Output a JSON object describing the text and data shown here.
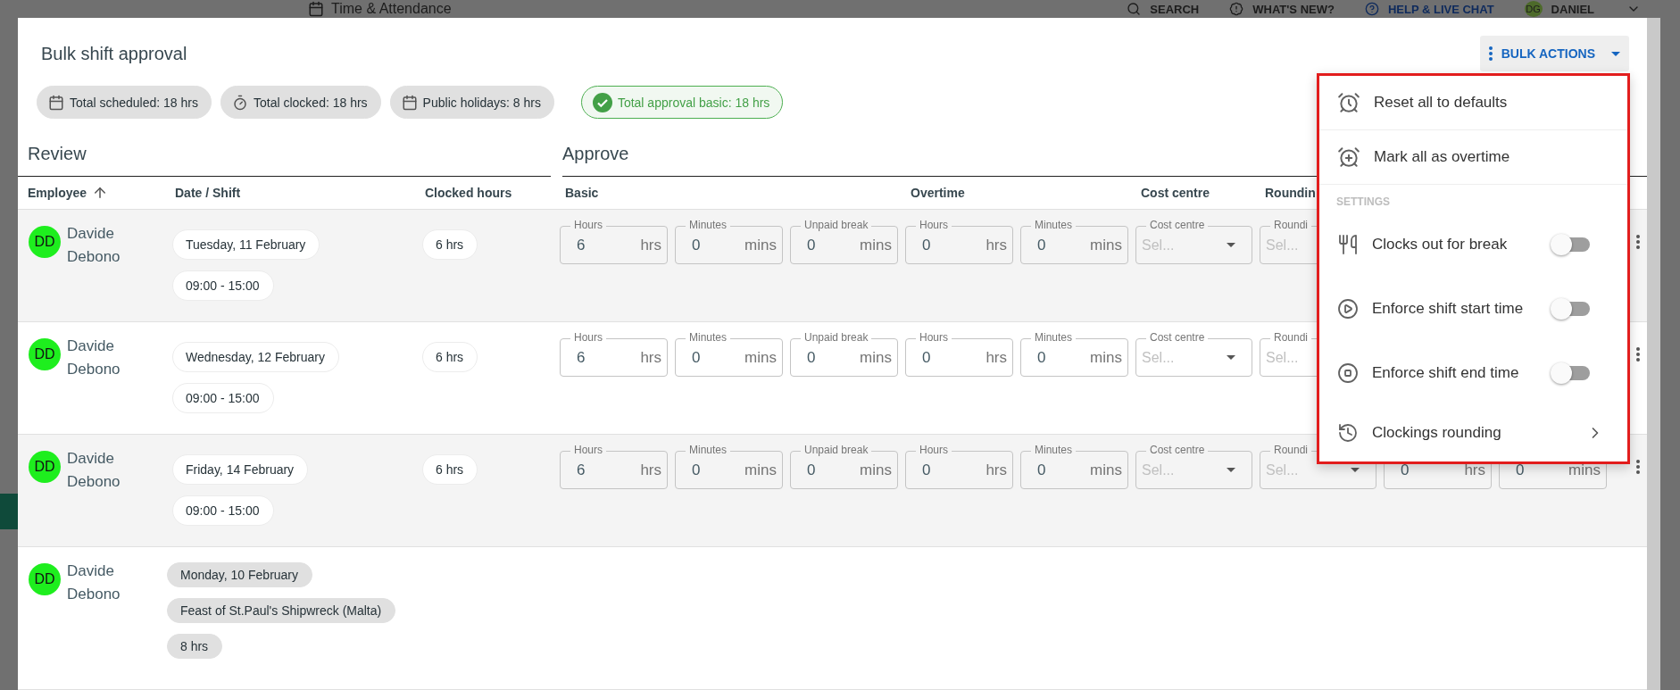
{
  "app_header": {
    "page_title": "Time & Attendance",
    "links": [
      {
        "label": "SEARCH"
      },
      {
        "label": "WHAT'S NEW?"
      },
      {
        "label": "HELP & LIVE CHAT"
      }
    ],
    "user": {
      "initials": "DG",
      "name": "DANIEL"
    }
  },
  "dialog": {
    "title": "Bulk shift approval",
    "bulk_actions": {
      "label": "BULK ACTIONS"
    },
    "summary_chips": [
      {
        "kind": "scheduled",
        "label": "Total scheduled: 18 hrs"
      },
      {
        "kind": "clocked",
        "label": "Total clocked: 18 hrs"
      },
      {
        "kind": "holidays",
        "label": "Public holidays: 8 hrs"
      },
      {
        "kind": "approval",
        "label": "Total approval basic: 18 hrs"
      }
    ],
    "sections": [
      {
        "title": "Review"
      },
      {
        "title": "Approve"
      }
    ],
    "review_columns": [
      {
        "label": "Employee",
        "sorted": true
      },
      {
        "label": "Date / Shift",
        "sorted": false
      },
      {
        "label": "Clocked hours",
        "sorted": false
      }
    ],
    "approve_columns": [
      {
        "label": "Basic"
      },
      {
        "label": "Overtime"
      },
      {
        "label": "Cost centre"
      },
      {
        "label": "Roundin"
      }
    ],
    "rows": [
      {
        "kind": "shift",
        "employee": {
          "initials": "DD",
          "name": "Davide Debono"
        },
        "date": "Tuesday, 11 February",
        "shift": "09:00 - 15:00",
        "clocked": "6 hrs",
        "fields": [
          {
            "kind": "input",
            "label": "Hours",
            "value": "6",
            "unit": "hrs"
          },
          {
            "kind": "input",
            "label": "Minutes",
            "value": "0",
            "unit": "mins"
          },
          {
            "kind": "input",
            "label": "Unpaid break",
            "value": "0",
            "unit": "mins"
          },
          {
            "kind": "input",
            "label": "Hours",
            "value": "0",
            "unit": "hrs"
          },
          {
            "kind": "input",
            "label": "Minutes",
            "value": "0",
            "unit": "mins"
          },
          {
            "kind": "select",
            "label": "Cost centre",
            "placeholder": "Sel..."
          },
          {
            "kind": "select_cut",
            "label": "Roundi",
            "placeholder": "Sel..."
          }
        ]
      },
      {
        "kind": "shift",
        "employee": {
          "initials": "DD",
          "name": "Davide Debono"
        },
        "date": "Wednesday, 12 February",
        "shift": "09:00 - 15:00",
        "clocked": "6 hrs",
        "fields": [
          {
            "kind": "input",
            "label": "Hours",
            "value": "6",
            "unit": "hrs"
          },
          {
            "kind": "input",
            "label": "Minutes",
            "value": "0",
            "unit": "mins"
          },
          {
            "kind": "input",
            "label": "Unpaid break",
            "value": "0",
            "unit": "mins"
          },
          {
            "kind": "input",
            "label": "Hours",
            "value": "0",
            "unit": "hrs"
          },
          {
            "kind": "input",
            "label": "Minutes",
            "value": "0",
            "unit": "mins"
          },
          {
            "kind": "select",
            "label": "Cost centre",
            "placeholder": "Sel..."
          },
          {
            "kind": "select_cut",
            "label": "Roundi",
            "placeholder": "Sel..."
          }
        ]
      },
      {
        "kind": "shift",
        "employee": {
          "initials": "DD",
          "name": "Davide Debono"
        },
        "date": "Friday, 14 February",
        "shift": "09:00 - 15:00",
        "clocked": "6 hrs",
        "fields": [
          {
            "kind": "input",
            "label": "Hours",
            "value": "6",
            "unit": "hrs"
          },
          {
            "kind": "input",
            "label": "Minutes",
            "value": "0",
            "unit": "mins"
          },
          {
            "kind": "input",
            "label": "Unpaid break",
            "value": "0",
            "unit": "mins"
          },
          {
            "kind": "input",
            "label": "Hours",
            "value": "0",
            "unit": "hrs"
          },
          {
            "kind": "input",
            "label": "Minutes",
            "value": "0",
            "unit": "mins"
          },
          {
            "kind": "select",
            "label": "Cost centre",
            "placeholder": "Sel..."
          },
          {
            "kind": "select",
            "label": "Roundi",
            "placeholder": "Sel..."
          },
          {
            "kind": "input",
            "value": "0",
            "unit": "hrs"
          },
          {
            "kind": "input",
            "value": "0",
            "unit": "mins"
          }
        ]
      },
      {
        "kind": "holiday",
        "employee": {
          "initials": "DD",
          "name": "Davide Debono"
        },
        "chips": [
          "Monday, 10 February",
          "Feast of St.Paul's Shipwreck (Malta)",
          "8 hrs"
        ]
      }
    ],
    "menu": {
      "actions": [
        {
          "label": "Reset all to defaults"
        },
        {
          "label": "Mark all as overtime"
        }
      ],
      "section_label": "SETTINGS",
      "settings": [
        {
          "kind": "toggle",
          "label": "Clocks out for break",
          "on": false
        },
        {
          "kind": "toggle",
          "label": "Enforce shift start time",
          "on": false
        },
        {
          "kind": "toggle",
          "label": "Enforce shift end time",
          "on": false
        },
        {
          "kind": "submenu",
          "label": "Clockings rounding"
        }
      ]
    }
  }
}
